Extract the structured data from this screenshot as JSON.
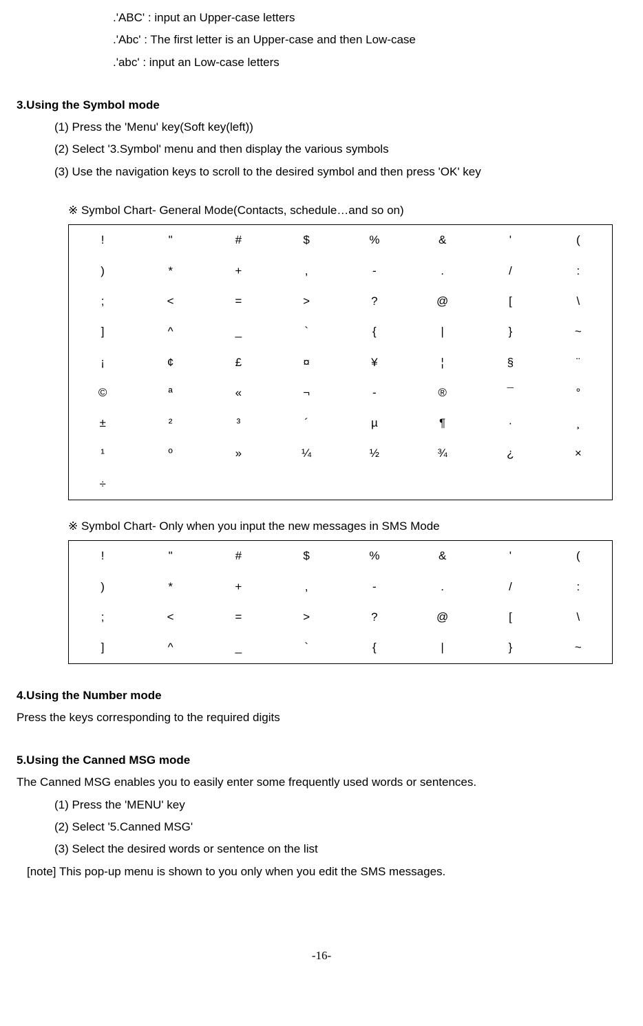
{
  "intro": {
    "lines": [
      ".'ABC' : input an Upper-case letters",
      ".'Abc' : The first letter is an Upper-case and then Low-case",
      ".'abc' : input an Low-case letters"
    ]
  },
  "section3": {
    "title": "3.Using the Symbol mode",
    "steps": [
      "(1) Press the 'Menu' key(Soft key(left))",
      "(2) Select '3.Symbol' menu and then display the various symbols",
      "(3) Use the navigation keys to scroll to the desired symbol and then press 'OK' key"
    ],
    "chart1_title": "※ Symbol Chart- General Mode(Contacts, schedule…and so on)",
    "chart2_title": "※ Symbol Chart- Only when you input the new messages in SMS Mode"
  },
  "section4": {
    "title": "4.Using the Number mode",
    "desc": "Press the keys corresponding to the required digits"
  },
  "section5": {
    "title": "5.Using the Canned MSG mode",
    "desc": "The Canned MSG enables you to easily enter some frequently used words or sentences.",
    "steps": [
      "(1) Press the 'MENU' key",
      "(2) Select '5.Canned MSG'",
      "(3) Select the desired words or sentence on the list"
    ],
    "note": "[note] This pop-up menu is shown to you only when you edit the SMS messages."
  },
  "page_number": "-16-",
  "chart_data": [
    {
      "type": "table",
      "rows": [
        [
          "!",
          "\"",
          "#",
          "$",
          "%",
          "&",
          "'",
          "("
        ],
        [
          ")",
          "*",
          "+",
          ",",
          "-",
          ".",
          "/",
          ":"
        ],
        [
          ";",
          "<",
          "=",
          ">",
          "?",
          "@",
          "[",
          "\\"
        ],
        [
          "]",
          "^",
          "_",
          "`",
          "{",
          "|",
          "}",
          "~"
        ],
        [
          "¡",
          "¢",
          "£",
          "¤",
          "¥",
          "¦",
          "§",
          "¨"
        ],
        [
          "©",
          "ª",
          "«",
          "¬",
          "-",
          "®",
          "¯",
          "°"
        ],
        [
          "±",
          "²",
          "³",
          "´",
          "µ",
          "¶",
          "·",
          "¸"
        ],
        [
          "¹",
          "º",
          "»",
          "¼",
          "½",
          "¾",
          "¿",
          "×"
        ],
        [
          "÷",
          "",
          "",
          "",
          "",
          "",
          "",
          ""
        ]
      ]
    },
    {
      "type": "table",
      "rows": [
        [
          "!",
          "\"",
          "#",
          "$",
          "%",
          "&",
          "'",
          "("
        ],
        [
          ")",
          "*",
          "+",
          ",",
          "-",
          ".",
          "/",
          ":"
        ],
        [
          ";",
          "<",
          "=",
          ">",
          "?",
          "@",
          "[",
          "\\"
        ],
        [
          "]",
          "^",
          "_",
          "`",
          "{",
          "|",
          "}",
          "~"
        ]
      ]
    }
  ]
}
